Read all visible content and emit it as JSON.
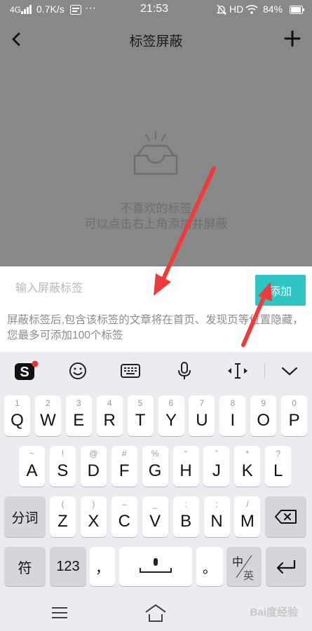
{
  "status_bar": {
    "network": "4G",
    "signal": "▏▎▍▌",
    "speed": "0.7K/s",
    "time": "21:53",
    "hd": "HD",
    "battery": "84%"
  },
  "nav": {
    "title": "标签屏蔽",
    "back_icon": "chevron-left-icon",
    "add_icon": "plus-icon"
  },
  "empty_state": {
    "line1": "不喜欢的标签",
    "line2": "可以点击右上角添加并屏蔽",
    "icon": "empty-inbox-icon"
  },
  "input_panel": {
    "placeholder": "输入屏蔽标签",
    "value": "",
    "add_label": "添加",
    "hint": "屏蔽标签后,包含该标签的文章将在首页、发现页等位置隐藏，您最多可添加100个标签"
  },
  "annotations": {
    "arrow_color": "#ee3b3b"
  },
  "ime_toolbar": {
    "items": [
      "sogou-logo-icon",
      "emoji-icon",
      "keyboard-icon",
      "microphone-icon",
      "cursor-icon",
      "collapse-chevron-icon"
    ]
  },
  "keyboard": {
    "row1": [
      {
        "main": "Q",
        "sub": "1"
      },
      {
        "main": "W",
        "sub": "2"
      },
      {
        "main": "E",
        "sub": "3"
      },
      {
        "main": "R",
        "sub": "4"
      },
      {
        "main": "T",
        "sub": "5"
      },
      {
        "main": "Y",
        "sub": "6"
      },
      {
        "main": "U",
        "sub": "7"
      },
      {
        "main": "I",
        "sub": "8"
      },
      {
        "main": "O",
        "sub": "9"
      },
      {
        "main": "P",
        "sub": "0"
      }
    ],
    "row2": [
      {
        "main": "A",
        "sub": "~"
      },
      {
        "main": "S",
        "sub": "!"
      },
      {
        "main": "D",
        "sub": "@"
      },
      {
        "main": "F",
        "sub": "#"
      },
      {
        "main": "G",
        "sub": "%"
      },
      {
        "main": "H",
        "sub": "“"
      },
      {
        "main": "J",
        "sub": "”"
      },
      {
        "main": "K",
        "sub": "*"
      },
      {
        "main": "L",
        "sub": "?"
      }
    ],
    "row3": [
      {
        "main": "Z",
        "sub": "("
      },
      {
        "main": "X",
        "sub": ")"
      },
      {
        "main": "C",
        "sub": "–"
      },
      {
        "main": "V",
        "sub": "_"
      },
      {
        "main": "B",
        "sub": ":"
      },
      {
        "main": "N",
        "sub": ";"
      },
      {
        "main": "M",
        "sub": "/"
      }
    ],
    "fenci": "分词",
    "symbols": "符",
    "numbers": "123",
    "comma": "，",
    "period": "。",
    "lang_top": "中",
    "lang_bottom": "英"
  },
  "bottom_bar": {
    "watermark": "Bai度经验"
  }
}
